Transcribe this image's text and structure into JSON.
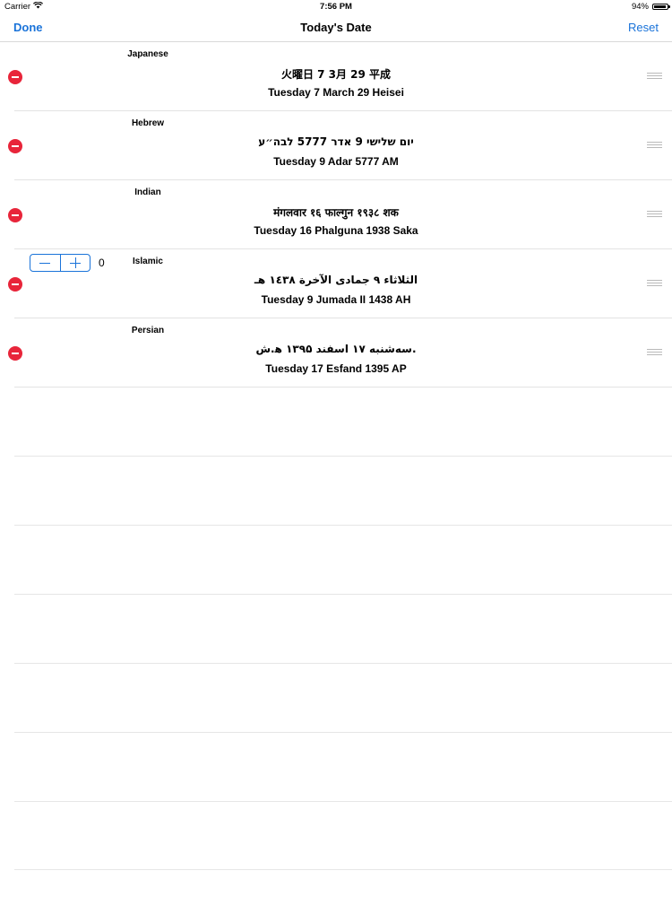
{
  "status_bar": {
    "carrier": "Carrier",
    "time": "7:56 PM",
    "battery": "94%",
    "battery_level": 0.94
  },
  "nav": {
    "done_label": "Done",
    "title": "Today's Date",
    "reset_label": "Reset"
  },
  "rows": [
    {
      "label": "Japanese",
      "native": "火曜日 7 3月 29 平成",
      "english": "Tuesday  7 March 29 Heisei"
    },
    {
      "label": "Hebrew",
      "native": "יום שלישי 9 אדר 5777 לבה״ע",
      "english": "Tuesday  9 Adar 5777 AM"
    },
    {
      "label": "Indian",
      "native": "मंगलवार १६ फाल्गुन १९३८ शक",
      "english": "Tuesday  16 Phalguna 1938 Saka"
    },
    {
      "label": "Islamic",
      "native": "الثلاثاء ٩ جمادى الآخرة ١٤٣٨ هـ",
      "english": "Tuesday  9 Jumada II 1438 AH"
    },
    {
      "label": "Persian",
      "native": "سه‌شنبه ۱۷ اسفند ۱۳۹۵ ه‍.ش.",
      "english": "Tuesday  17 Esfand 1395 AP"
    }
  ],
  "stepper": {
    "value": "0"
  },
  "colors": {
    "accent": "#1a73d9",
    "delete": "#e8253a",
    "separator": "#e3e3e3"
  }
}
